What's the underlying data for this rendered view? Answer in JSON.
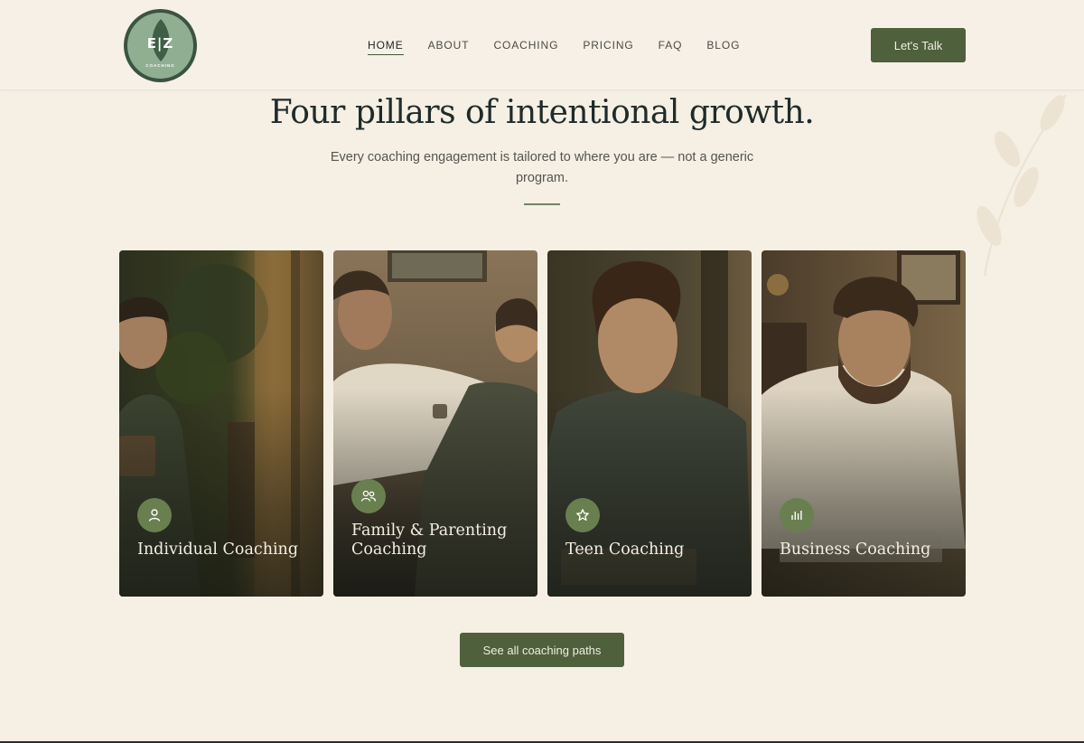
{
  "header": {
    "logo": {
      "mark": "E|Z",
      "tagline": "COACHING"
    },
    "nav": [
      "HOME",
      "ABOUT",
      "COACHING",
      "PRICING",
      "FAQ",
      "BLOG"
    ],
    "nav_active": "HOME",
    "cta_label": "Let's Talk"
  },
  "hero": {
    "title": "Four pillars of intentional growth.",
    "subtitle": "Every coaching engagement is tailored to where you are — not a generic program."
  },
  "cards": [
    {
      "title": "Individual Coaching",
      "icon": "person-icon"
    },
    {
      "title": "Family & Parenting Coaching",
      "icon": "people-icon"
    },
    {
      "title": "Teen Coaching",
      "icon": "star-icon"
    },
    {
      "title": "Business Coaching",
      "icon": "bar-chart-icon"
    }
  ],
  "cta_bottom_label": "See all coaching paths",
  "colors": {
    "background": "#f5efe4",
    "accent": "#4f603c",
    "icon_circle": "#6a7f4f",
    "logo_ring": "#3b5341",
    "logo_fill": "#8fae92"
  }
}
